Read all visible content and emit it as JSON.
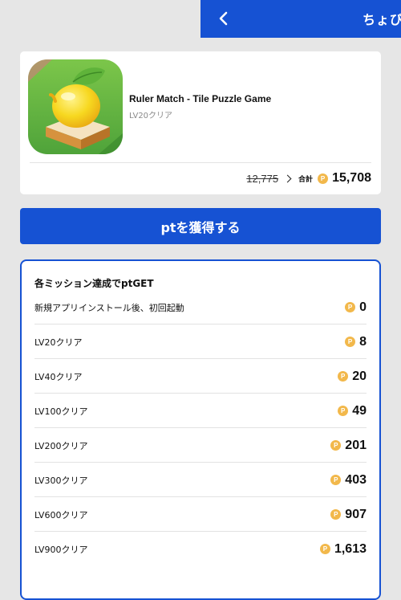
{
  "header": {
    "title": "ちょび"
  },
  "app": {
    "name": "Ruler Match - Tile Puzzle Game",
    "subtitle": "LV20クリア",
    "old_price": "12,775",
    "total_label": "合計",
    "total_points": "15,708"
  },
  "coin_symbol": "P",
  "earn_button": "ptを獲得する",
  "missions": {
    "heading": "各ミッション達成でptGET",
    "items": [
      {
        "label": "新規アプリインストール後、初回起動",
        "points": "0"
      },
      {
        "label": "LV20クリア",
        "points": "8"
      },
      {
        "label": "LV40クリア",
        "points": "20"
      },
      {
        "label": "LV100クリア",
        "points": "49"
      },
      {
        "label": "LV200クリア",
        "points": "201"
      },
      {
        "label": "LV300クリア",
        "points": "403"
      },
      {
        "label": "LV600クリア",
        "points": "907"
      },
      {
        "label": "LV900クリア",
        "points": "1,613"
      }
    ]
  },
  "colors": {
    "brand_blue": "#1652d3",
    "coin": "#f2b84b",
    "background": "#e6e6e6"
  },
  "icons": {
    "back": "chevron-left-icon",
    "arrow": "chevron-right-icon",
    "coin": "point-coin-icon"
  }
}
